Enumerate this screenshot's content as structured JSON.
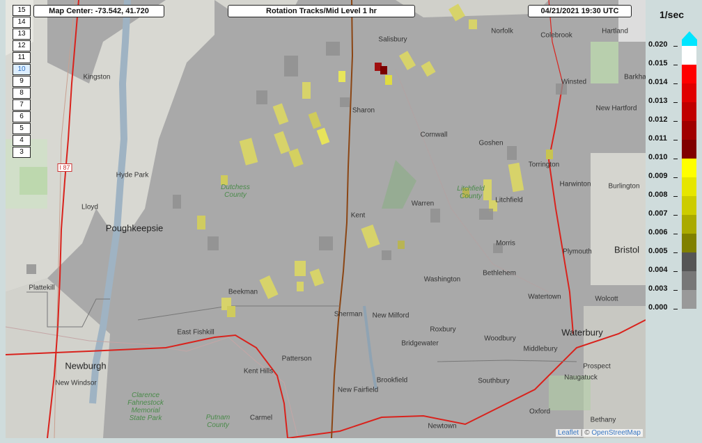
{
  "header": {
    "map_center": "Map Center: -73.542, 41.720",
    "product": "Rotation Tracks/Mid Level 1 hr",
    "datetime": "04/21/2021   19:30 UTC"
  },
  "zoom_levels": [
    "15",
    "14",
    "13",
    "12",
    "11",
    "10",
    "9",
    "8",
    "7",
    "6",
    "5",
    "4",
    "3"
  ],
  "zoom_selected": "10",
  "places": [
    {
      "name": "Salisbury",
      "cls": ""
    },
    {
      "name": "Norfolk",
      "cls": ""
    },
    {
      "name": "Colebrook",
      "cls": ""
    },
    {
      "name": "Hartland",
      "cls": ""
    },
    {
      "name": "Kingston",
      "cls": ""
    },
    {
      "name": "Winsted",
      "cls": ""
    },
    {
      "name": "Barkha",
      "cls": ""
    },
    {
      "name": "Sharon",
      "cls": ""
    },
    {
      "name": "New Hartford",
      "cls": ""
    },
    {
      "name": "Cornwall",
      "cls": ""
    },
    {
      "name": "Goshen",
      "cls": ""
    },
    {
      "name": "Torrington",
      "cls": ""
    },
    {
      "name": "Hyde Park",
      "cls": ""
    },
    {
      "name": "Harwinton",
      "cls": ""
    },
    {
      "name": "Burlington",
      "cls": ""
    },
    {
      "name": "Dutchess County",
      "cls": "county"
    },
    {
      "name": "Litchfield County",
      "cls": "county"
    },
    {
      "name": "Lloyd",
      "cls": ""
    },
    {
      "name": "Litchfield",
      "cls": ""
    },
    {
      "name": "Warren",
      "cls": ""
    },
    {
      "name": "Kent",
      "cls": ""
    },
    {
      "name": "Poughkeepsie",
      "cls": "big"
    },
    {
      "name": "Morris",
      "cls": ""
    },
    {
      "name": "Bristol",
      "cls": "big"
    },
    {
      "name": "Plymouth",
      "cls": ""
    },
    {
      "name": "Bethlehem",
      "cls": ""
    },
    {
      "name": "Washington",
      "cls": ""
    },
    {
      "name": "Plattekill",
      "cls": ""
    },
    {
      "name": "Beekman",
      "cls": ""
    },
    {
      "name": "Watertown",
      "cls": ""
    },
    {
      "name": "Wolcott",
      "cls": ""
    },
    {
      "name": "Sherman",
      "cls": ""
    },
    {
      "name": "New Milford",
      "cls": ""
    },
    {
      "name": "East Fishkill",
      "cls": ""
    },
    {
      "name": "Roxbury",
      "cls": ""
    },
    {
      "name": "Waterbury",
      "cls": "big"
    },
    {
      "name": "Woodbury",
      "cls": ""
    },
    {
      "name": "Bridgewater",
      "cls": ""
    },
    {
      "name": "Middlebury",
      "cls": ""
    },
    {
      "name": "Patterson",
      "cls": ""
    },
    {
      "name": "Newburgh",
      "cls": "big"
    },
    {
      "name": "Prospect",
      "cls": ""
    },
    {
      "name": "Kent Hills",
      "cls": ""
    },
    {
      "name": "Brookfield",
      "cls": ""
    },
    {
      "name": "Naugatuck",
      "cls": ""
    },
    {
      "name": "New Windsor",
      "cls": ""
    },
    {
      "name": "Southbury",
      "cls": ""
    },
    {
      "name": "Clarence Fahnestock Memorial State Park",
      "cls": "county"
    },
    {
      "name": "New Fairfield",
      "cls": ""
    },
    {
      "name": "Putnam County",
      "cls": "county"
    },
    {
      "name": "Carmel",
      "cls": ""
    },
    {
      "name": "Oxford",
      "cls": ""
    },
    {
      "name": "Bethany",
      "cls": ""
    },
    {
      "name": "Newtown",
      "cls": ""
    },
    {
      "name": "I 87",
      "cls": ""
    }
  ],
  "attribution": {
    "leaflet": "Leaflet",
    "sep": " | © ",
    "osm": "OpenStreetMap"
  },
  "legend": {
    "title": "1/sec",
    "rows": [
      {
        "label": "0.020",
        "color": "#ffffff"
      },
      {
        "label": "0.015",
        "color": "#ff0000"
      },
      {
        "label": "0.014",
        "color": "#e00000"
      },
      {
        "label": "0.013",
        "color": "#c00000"
      },
      {
        "label": "0.012",
        "color": "#a00000"
      },
      {
        "label": "0.011",
        "color": "#800000"
      },
      {
        "label": "0.010",
        "color": "#ffff00"
      },
      {
        "label": "0.009",
        "color": "#e6e600"
      },
      {
        "label": "0.008",
        "color": "#cccc00"
      },
      {
        "label": "0.007",
        "color": "#aaaa00"
      },
      {
        "label": "0.006",
        "color": "#808000"
      },
      {
        "label": "0.005",
        "color": "#555555"
      },
      {
        "label": "0.004",
        "color": "#777777"
      },
      {
        "label": "0.003",
        "color": "#999999"
      },
      {
        "label": "0.000",
        "color": "#999999"
      }
    ],
    "top_arrow_color": "#00e5ff"
  }
}
